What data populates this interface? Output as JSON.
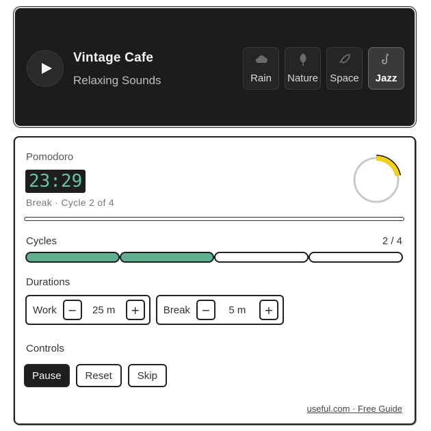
{
  "player": {
    "title": "Vintage Cafe",
    "subtitle": "Relaxing Sounds",
    "play_icon": "play-icon",
    "sounds": [
      {
        "label": "Rain",
        "icon": "cloud-icon",
        "active": false
      },
      {
        "label": "Nature",
        "icon": "leaf-icon",
        "active": false
      },
      {
        "label": "Space",
        "icon": "rocket-icon",
        "active": false
      },
      {
        "label": "Jazz",
        "icon": "saxophone-icon",
        "active": true
      }
    ]
  },
  "pomodoro": {
    "label": "Pomodoro",
    "timer": "23:29",
    "phase": "Break · Cycle 2 of 4",
    "ring_progress": 0.22,
    "ring_color": "#f2d11b",
    "cycles": {
      "label": "Cycles",
      "count": "2 / 4",
      "completed": 2,
      "total": 4,
      "fill_color": "#5fae90"
    },
    "durations": {
      "label": "Durations",
      "work": {
        "name": "Work",
        "value": "25 m",
        "minus": "−",
        "plus": "+"
      },
      "break": {
        "name": "Break",
        "value": "5 m",
        "minus": "−",
        "plus": "+"
      }
    },
    "controls": {
      "label": "Controls",
      "pause": "Pause",
      "reset": "Reset",
      "skip": "Skip"
    },
    "footer": "useful.com · Free Guide"
  }
}
